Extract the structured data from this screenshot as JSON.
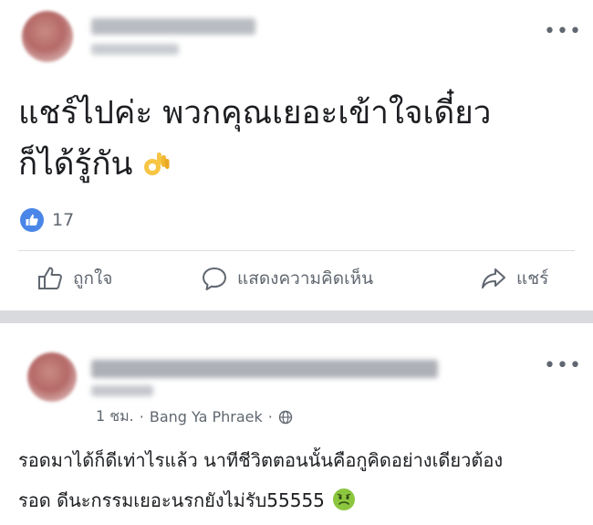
{
  "post": {
    "text_line1": "แชร์ไปค่ะ พวกคุณเยอะเข้าใจเดี๋ยว",
    "text_line2": "ก็ได้รู้กัน",
    "emoji": "ok-hand",
    "reaction_count": "17",
    "more_label": "•••"
  },
  "actions": {
    "like_label": "ถูกใจ",
    "comment_label": "แสดงความคิดเห็น",
    "share_label": "แชร์"
  },
  "comment": {
    "time": "1 ชม.",
    "separator": "·",
    "location": "Bang Ya Phraek",
    "more_label": "•••",
    "text_line1": "รอดมาได้ก็ดีเท่าไรแล้ว นาทีชีวิตตอนนั้นคือกูคิดอย่างเดียวต้อง",
    "text_line2": "รอด ดีนะกรรมเยอะนรกยังไม่รับ55555",
    "emoji": "nauseated-face"
  },
  "colors": {
    "like_blue": "#4a86e8",
    "secondary_text": "#606770",
    "separator_gray": "#d8dade"
  }
}
